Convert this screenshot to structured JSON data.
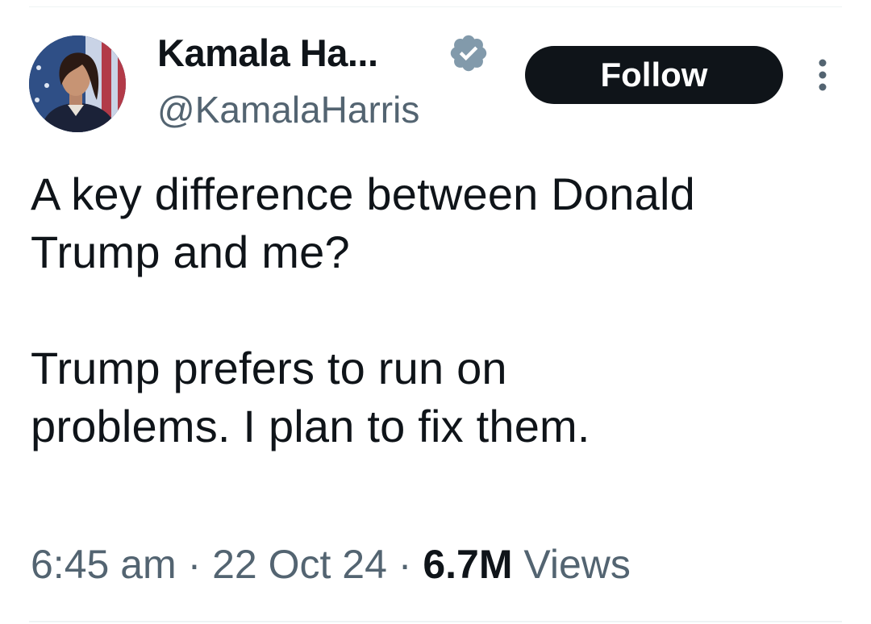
{
  "tweet": {
    "author": {
      "display_name": "Kamala Ha...",
      "handle": "@KamalaHarris",
      "verified": true,
      "verified_badge_color": "#829aab"
    },
    "follow_label": "Follow",
    "text": "A key difference between Donald\nTrump and me?\n\nTrump prefers to run on\nproblems. I plan to fix them.",
    "time": "6:45 am",
    "separator": " · ",
    "date": "22 Oct 24",
    "views_count": "6.7M",
    "views_label": "Views"
  },
  "icons": {
    "verified": "verified-badge-icon",
    "more": "more-vertical-icon"
  },
  "colors": {
    "text": "#0f1419",
    "secondary_text": "#536471",
    "follow_bg": "#0f1419",
    "follow_text": "#ffffff"
  }
}
